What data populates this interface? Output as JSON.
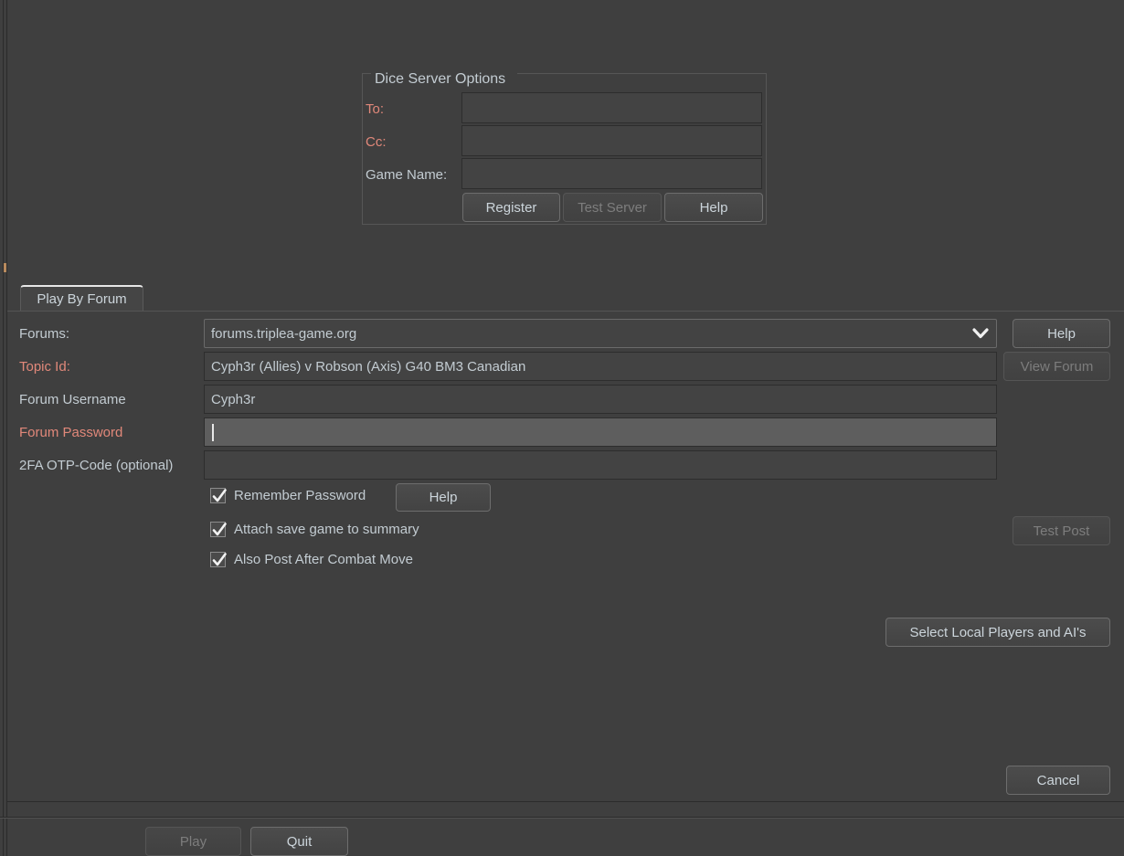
{
  "dice_server": {
    "title": "Dice Server Options",
    "to_label": "To:",
    "to_value": "",
    "cc_label": "Cc:",
    "cc_value": "",
    "game_name_label": "Game Name:",
    "game_name_value": "",
    "register_label": "Register",
    "test_server_label": "Test Server",
    "help_label": "Help"
  },
  "tab": {
    "play_by_forum_label": "Play By Forum"
  },
  "forum": {
    "forums_label": "Forums:",
    "forums_value": "forums.triplea-game.org",
    "topic_id_label": "Topic Id:",
    "topic_id_value": "Cyph3r (Allies) v Robson (Axis) G40 BM3 Canadian",
    "username_label": "Forum Username",
    "username_value": "Cyph3r",
    "password_label": "Forum Password",
    "password_value": "",
    "otp_label": "2FA OTP-Code (optional)",
    "otp_value": "",
    "help_label": "Help",
    "view_forum_label": "View Forum",
    "test_post_label": "Test Post",
    "password_help_label": "Help"
  },
  "checkboxes": [
    {
      "label": "Remember Password",
      "checked": true
    },
    {
      "label": "Attach save game to summary",
      "checked": true
    },
    {
      "label": "Also Post After Combat Move",
      "checked": true
    }
  ],
  "actions": {
    "select_players_label": "Select Local Players and AI's",
    "cancel_label": "Cancel",
    "play_label": "Play",
    "quit_label": "Quit"
  },
  "colors": {
    "background": "#3f3f3f",
    "text": "#c3ccd2",
    "required_label": "#e1887a",
    "field_background": "#434343",
    "field_focused": "#5e5e5e",
    "disabled_text": "#7d7d7d",
    "tab_highlight": "#e6e6e6"
  },
  "icons": {
    "chevron_down": "chevron-down-icon",
    "checkmark": "checkmark-icon"
  }
}
